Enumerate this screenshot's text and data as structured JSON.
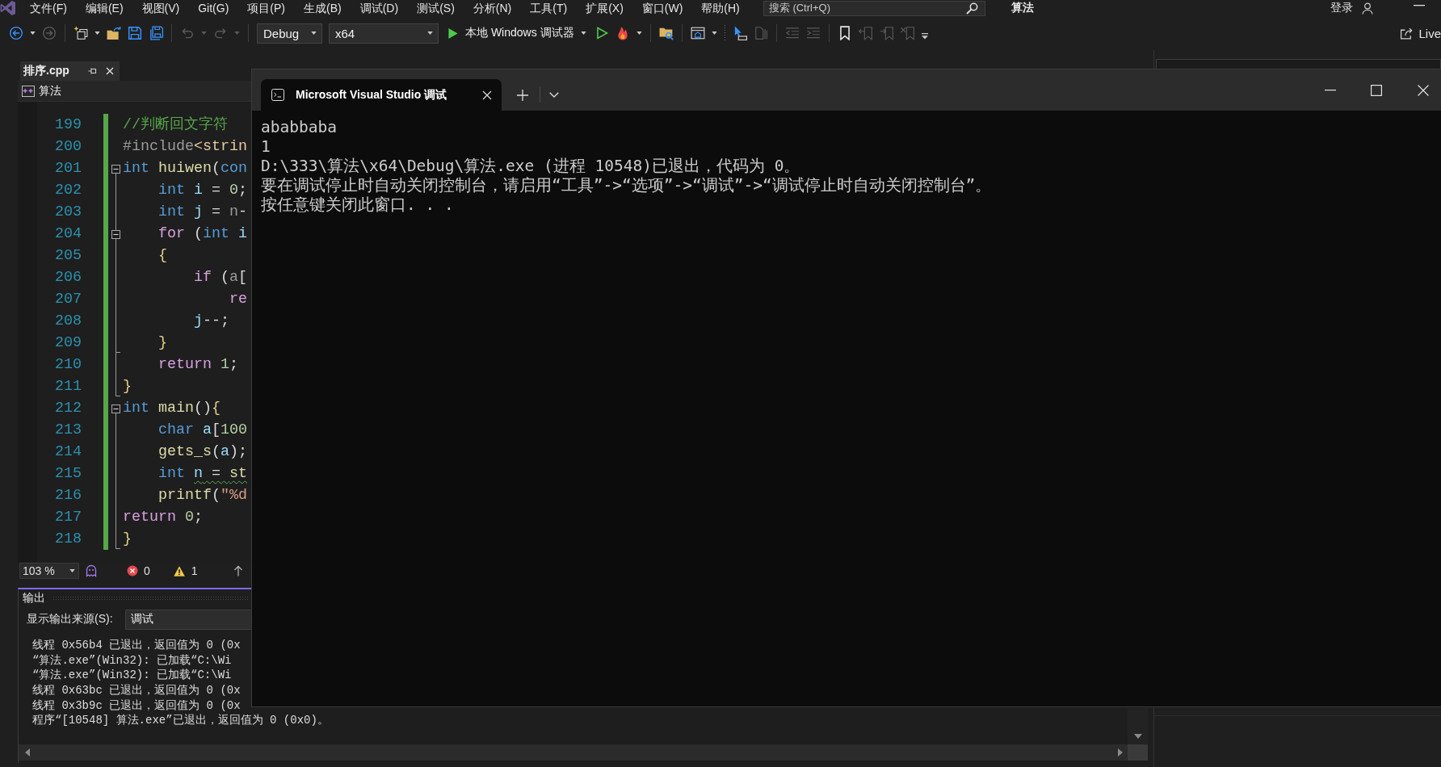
{
  "menu_bar": {
    "items": [
      "文件(F)",
      "编辑(E)",
      "视图(V)",
      "Git(G)",
      "项目(P)",
      "生成(B)",
      "调试(D)",
      "测试(S)",
      "分析(N)",
      "工具(T)",
      "扩展(X)",
      "窗口(W)",
      "帮助(H)"
    ],
    "search": {
      "placeholder": "搜索 (Ctrl+Q)"
    },
    "solution_name": "算法",
    "sign_in": "登录"
  },
  "toolbar": {
    "items": [
      {
        "kind": "split",
        "disabled": false
      },
      {
        "kind": "button",
        "disabled": true
      },
      {
        "kind": "separator"
      },
      {
        "kind": "split",
        "disabled": false
      },
      {
        "kind": "button",
        "disabled": false
      },
      {
        "kind": "button",
        "disabled": false
      },
      {
        "kind": "button",
        "disabled": false
      },
      {
        "kind": "separator"
      },
      {
        "kind": "split",
        "disabled": true
      },
      {
        "kind": "split",
        "disabled": true
      },
      {
        "kind": "separator"
      },
      {
        "kind": "dropdown",
        "value": "Debug"
      },
      {
        "kind": "dropdown",
        "value": "x64"
      },
      {
        "kind": "run",
        "label": "本地 Windows 调试器"
      },
      {
        "kind": "button",
        "disabled": false
      },
      {
        "kind": "split",
        "disabled": false
      },
      {
        "kind": "separator"
      },
      {
        "kind": "button",
        "disabled": false
      },
      {
        "kind": "separator"
      },
      {
        "kind": "split",
        "disabled": false
      },
      {
        "kind": "grip"
      },
      {
        "kind": "button",
        "disabled": false
      },
      {
        "kind": "button",
        "disabled": true
      },
      {
        "kind": "separator"
      },
      {
        "kind": "button",
        "disabled": true
      },
      {
        "kind": "button",
        "disabled": true
      },
      {
        "kind": "separator"
      },
      {
        "kind": "button",
        "disabled": false
      },
      {
        "kind": "button",
        "disabled": true
      },
      {
        "kind": "button",
        "disabled": true
      },
      {
        "kind": "button",
        "disabled": true
      },
      {
        "kind": "overflow"
      }
    ],
    "live_share": "Live"
  },
  "editor": {
    "tab": {
      "label": "排序.cpp",
      "selected": true
    },
    "project": "算法",
    "lines": [
      {
        "number": "199",
        "changed": true,
        "kind": "plain",
        "tokens": [
          {
            "text": "//判断回文字符",
            "kind": "comment"
          }
        ]
      },
      {
        "number": "200",
        "changed": true,
        "kind": "plain",
        "tokens": [
          {
            "text": "#include",
            "kind": "directive"
          },
          {
            "text": "<strin",
            "kind": "header"
          }
        ]
      },
      {
        "number": "201",
        "changed": true,
        "kind": "opener",
        "tokens": [
          {
            "text": "int",
            "kind": "keyword"
          },
          {
            "text": " huiwen",
            "kind": "function"
          },
          {
            "text": "(",
            "kind": "punct"
          },
          {
            "text": "con",
            "kind": "keyword"
          }
        ]
      },
      {
        "number": "202",
        "changed": true,
        "kind": "plain",
        "tokens": [
          {
            "text": "    int",
            "kind": "keyword"
          },
          {
            "text": " i",
            "kind": "variable"
          },
          {
            "text": " = ",
            "kind": "punct"
          },
          {
            "text": "0",
            "kind": "number"
          },
          {
            "text": ";",
            "kind": "punct"
          }
        ]
      },
      {
        "number": "203",
        "changed": true,
        "kind": "plain",
        "tokens": [
          {
            "text": "    int",
            "kind": "keyword"
          },
          {
            "text": " j",
            "kind": "variable"
          },
          {
            "text": " = ",
            "kind": "punct"
          },
          {
            "text": "n",
            "kind": "parameter"
          },
          {
            "text": "-",
            "kind": "punct"
          }
        ]
      },
      {
        "number": "204",
        "changed": true,
        "kind": "opener",
        "tokens": [
          {
            "text": "    for",
            "kind": "control"
          },
          {
            "text": " (",
            "kind": "punct"
          },
          {
            "text": "int",
            "kind": "keyword"
          },
          {
            "text": " i",
            "kind": "variable"
          }
        ]
      },
      {
        "number": "205",
        "changed": true,
        "kind": "plain",
        "tokens": [
          {
            "text": "    {",
            "kind": "brace"
          }
        ]
      },
      {
        "number": "206",
        "changed": true,
        "kind": "plain",
        "tokens": [
          {
            "text": "        if",
            "kind": "control"
          },
          {
            "text": " (",
            "kind": "punct"
          },
          {
            "text": "a",
            "kind": "parameter"
          },
          {
            "text": "[",
            "kind": "punct"
          }
        ]
      },
      {
        "number": "207",
        "changed": true,
        "kind": "plain",
        "tokens": [
          {
            "text": "            re",
            "kind": "control"
          }
        ]
      },
      {
        "number": "208",
        "changed": true,
        "kind": "plain",
        "tokens": [
          {
            "text": "        j",
            "kind": "variable"
          },
          {
            "text": "--;",
            "kind": "punct"
          }
        ]
      },
      {
        "number": "209",
        "changed": true,
        "kind": "closer",
        "tokens": [
          {
            "text": "    }",
            "kind": "brace"
          }
        ]
      },
      {
        "number": "210",
        "changed": true,
        "kind": "plain",
        "tokens": [
          {
            "text": "    return",
            "kind": "control"
          },
          {
            "text": " 1",
            "kind": "number"
          },
          {
            "text": ";",
            "kind": "punct"
          }
        ]
      },
      {
        "number": "211",
        "changed": true,
        "kind": "closer",
        "tokens": [
          {
            "text": "}",
            "kind": "brace"
          }
        ]
      },
      {
        "number": "212",
        "changed": true,
        "kind": "opener",
        "tokens": [
          {
            "text": "int",
            "kind": "keyword"
          },
          {
            "text": " main",
            "kind": "function"
          },
          {
            "text": "()",
            "kind": "punct"
          },
          {
            "text": "{",
            "kind": "brace"
          }
        ]
      },
      {
        "number": "213",
        "changed": true,
        "kind": "plain",
        "tokens": [
          {
            "text": "    char",
            "kind": "keyword"
          },
          {
            "text": " a",
            "kind": "variable"
          },
          {
            "text": "[",
            "kind": "punct"
          },
          {
            "text": "100",
            "kind": "number"
          }
        ]
      },
      {
        "number": "214",
        "changed": true,
        "kind": "plain",
        "tokens": [
          {
            "text": "    gets_s",
            "kind": "function"
          },
          {
            "text": "(",
            "kind": "punct"
          },
          {
            "text": "a",
            "kind": "variable"
          },
          {
            "text": ");",
            "kind": "punct"
          }
        ]
      },
      {
        "number": "215",
        "changed": true,
        "kind": "plain",
        "tokens": [
          {
            "text": "    int ",
            "kind": "keyword"
          }
        ],
        "squiggle": [
          {
            "text": "n",
            "kind": "variable"
          },
          {
            "text": " = ",
            "kind": "punct"
          },
          {
            "text": "st",
            "kind": "function"
          }
        ]
      },
      {
        "number": "216",
        "changed": true,
        "kind": "plain",
        "tokens": [
          {
            "text": "    printf",
            "kind": "function"
          },
          {
            "text": "(",
            "kind": "punct"
          },
          {
            "text": "\"%d",
            "kind": "string"
          }
        ]
      },
      {
        "number": "217",
        "changed": true,
        "kind": "plain",
        "tokens": [
          {
            "text": "return",
            "kind": "control"
          },
          {
            "text": " 0",
            "kind": "number"
          },
          {
            "text": ";",
            "kind": "punct"
          }
        ]
      },
      {
        "number": "218",
        "changed": true,
        "kind": "closer",
        "tokens": [
          {
            "text": "}",
            "kind": "brace"
          }
        ]
      }
    ]
  },
  "status_bar": {
    "zoom": "103 %",
    "errors": "0",
    "warnings": "1"
  },
  "output": {
    "title": "输出",
    "source_label": "显示输出来源(S):",
    "source_value": "调试",
    "lines": [
      "线程 0x56b4 已退出，返回值为 0 (0x",
      "“算法.exe”(Win32): 已加载“C:\\Wi",
      "“算法.exe”(Win32): 已加载“C:\\Wi",
      "线程 0x63bc 已退出，返回值为 0 (0x",
      "线程 0x3b9c 已退出，返回值为 0 (0x",
      "程序“[10548] 算法.exe”已退出，返回值为 0 (0x0)。"
    ]
  },
  "console": {
    "tab_title": "Microsoft Visual Studio 调试",
    "lines": [
      "ababbaba",
      "1",
      "D:\\333\\算法\\x64\\Debug\\算法.exe (进程 10548)已退出，代码为 0。",
      "要在调试停止时自动关闭控制台，请启用“工具”->“选项”->“调试”->“调试停止时自动关闭控制台”。",
      "按任意键关闭此窗口. . ."
    ]
  }
}
